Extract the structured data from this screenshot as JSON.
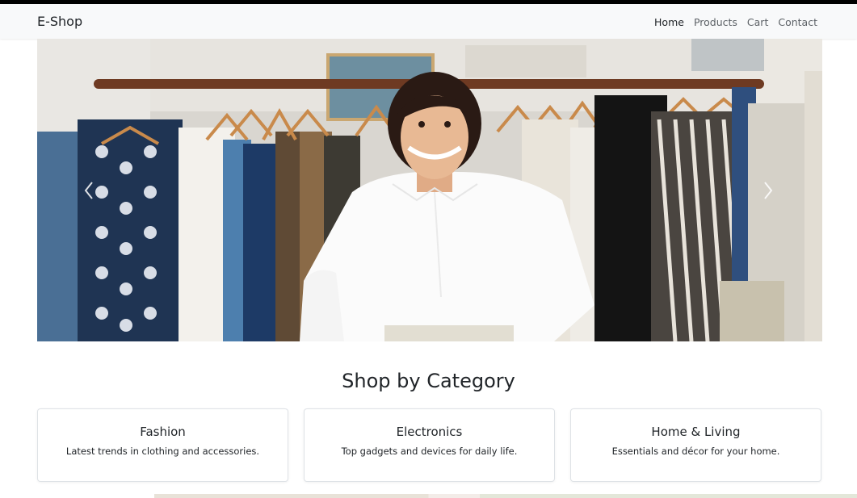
{
  "navbar": {
    "brand": "E-Shop",
    "links": [
      {
        "label": "Home",
        "active": true
      },
      {
        "label": "Products",
        "active": false
      },
      {
        "label": "Cart",
        "active": false
      },
      {
        "label": "Contact",
        "active": false
      }
    ]
  },
  "carousel": {
    "prev_icon": "chevron-left-icon",
    "next_icon": "chevron-right-icon"
  },
  "categories": {
    "title": "Shop by Category",
    "items": [
      {
        "title": "Fashion",
        "description": "Latest trends in clothing and accessories."
      },
      {
        "title": "Electronics",
        "description": "Top gadgets and devices for daily life."
      },
      {
        "title": "Home & Living",
        "description": "Essentials and décor for your home."
      }
    ]
  },
  "colors": {
    "navbar_bg": "#f8f9fa",
    "text": "#212529",
    "muted_link": "#5c6166"
  }
}
